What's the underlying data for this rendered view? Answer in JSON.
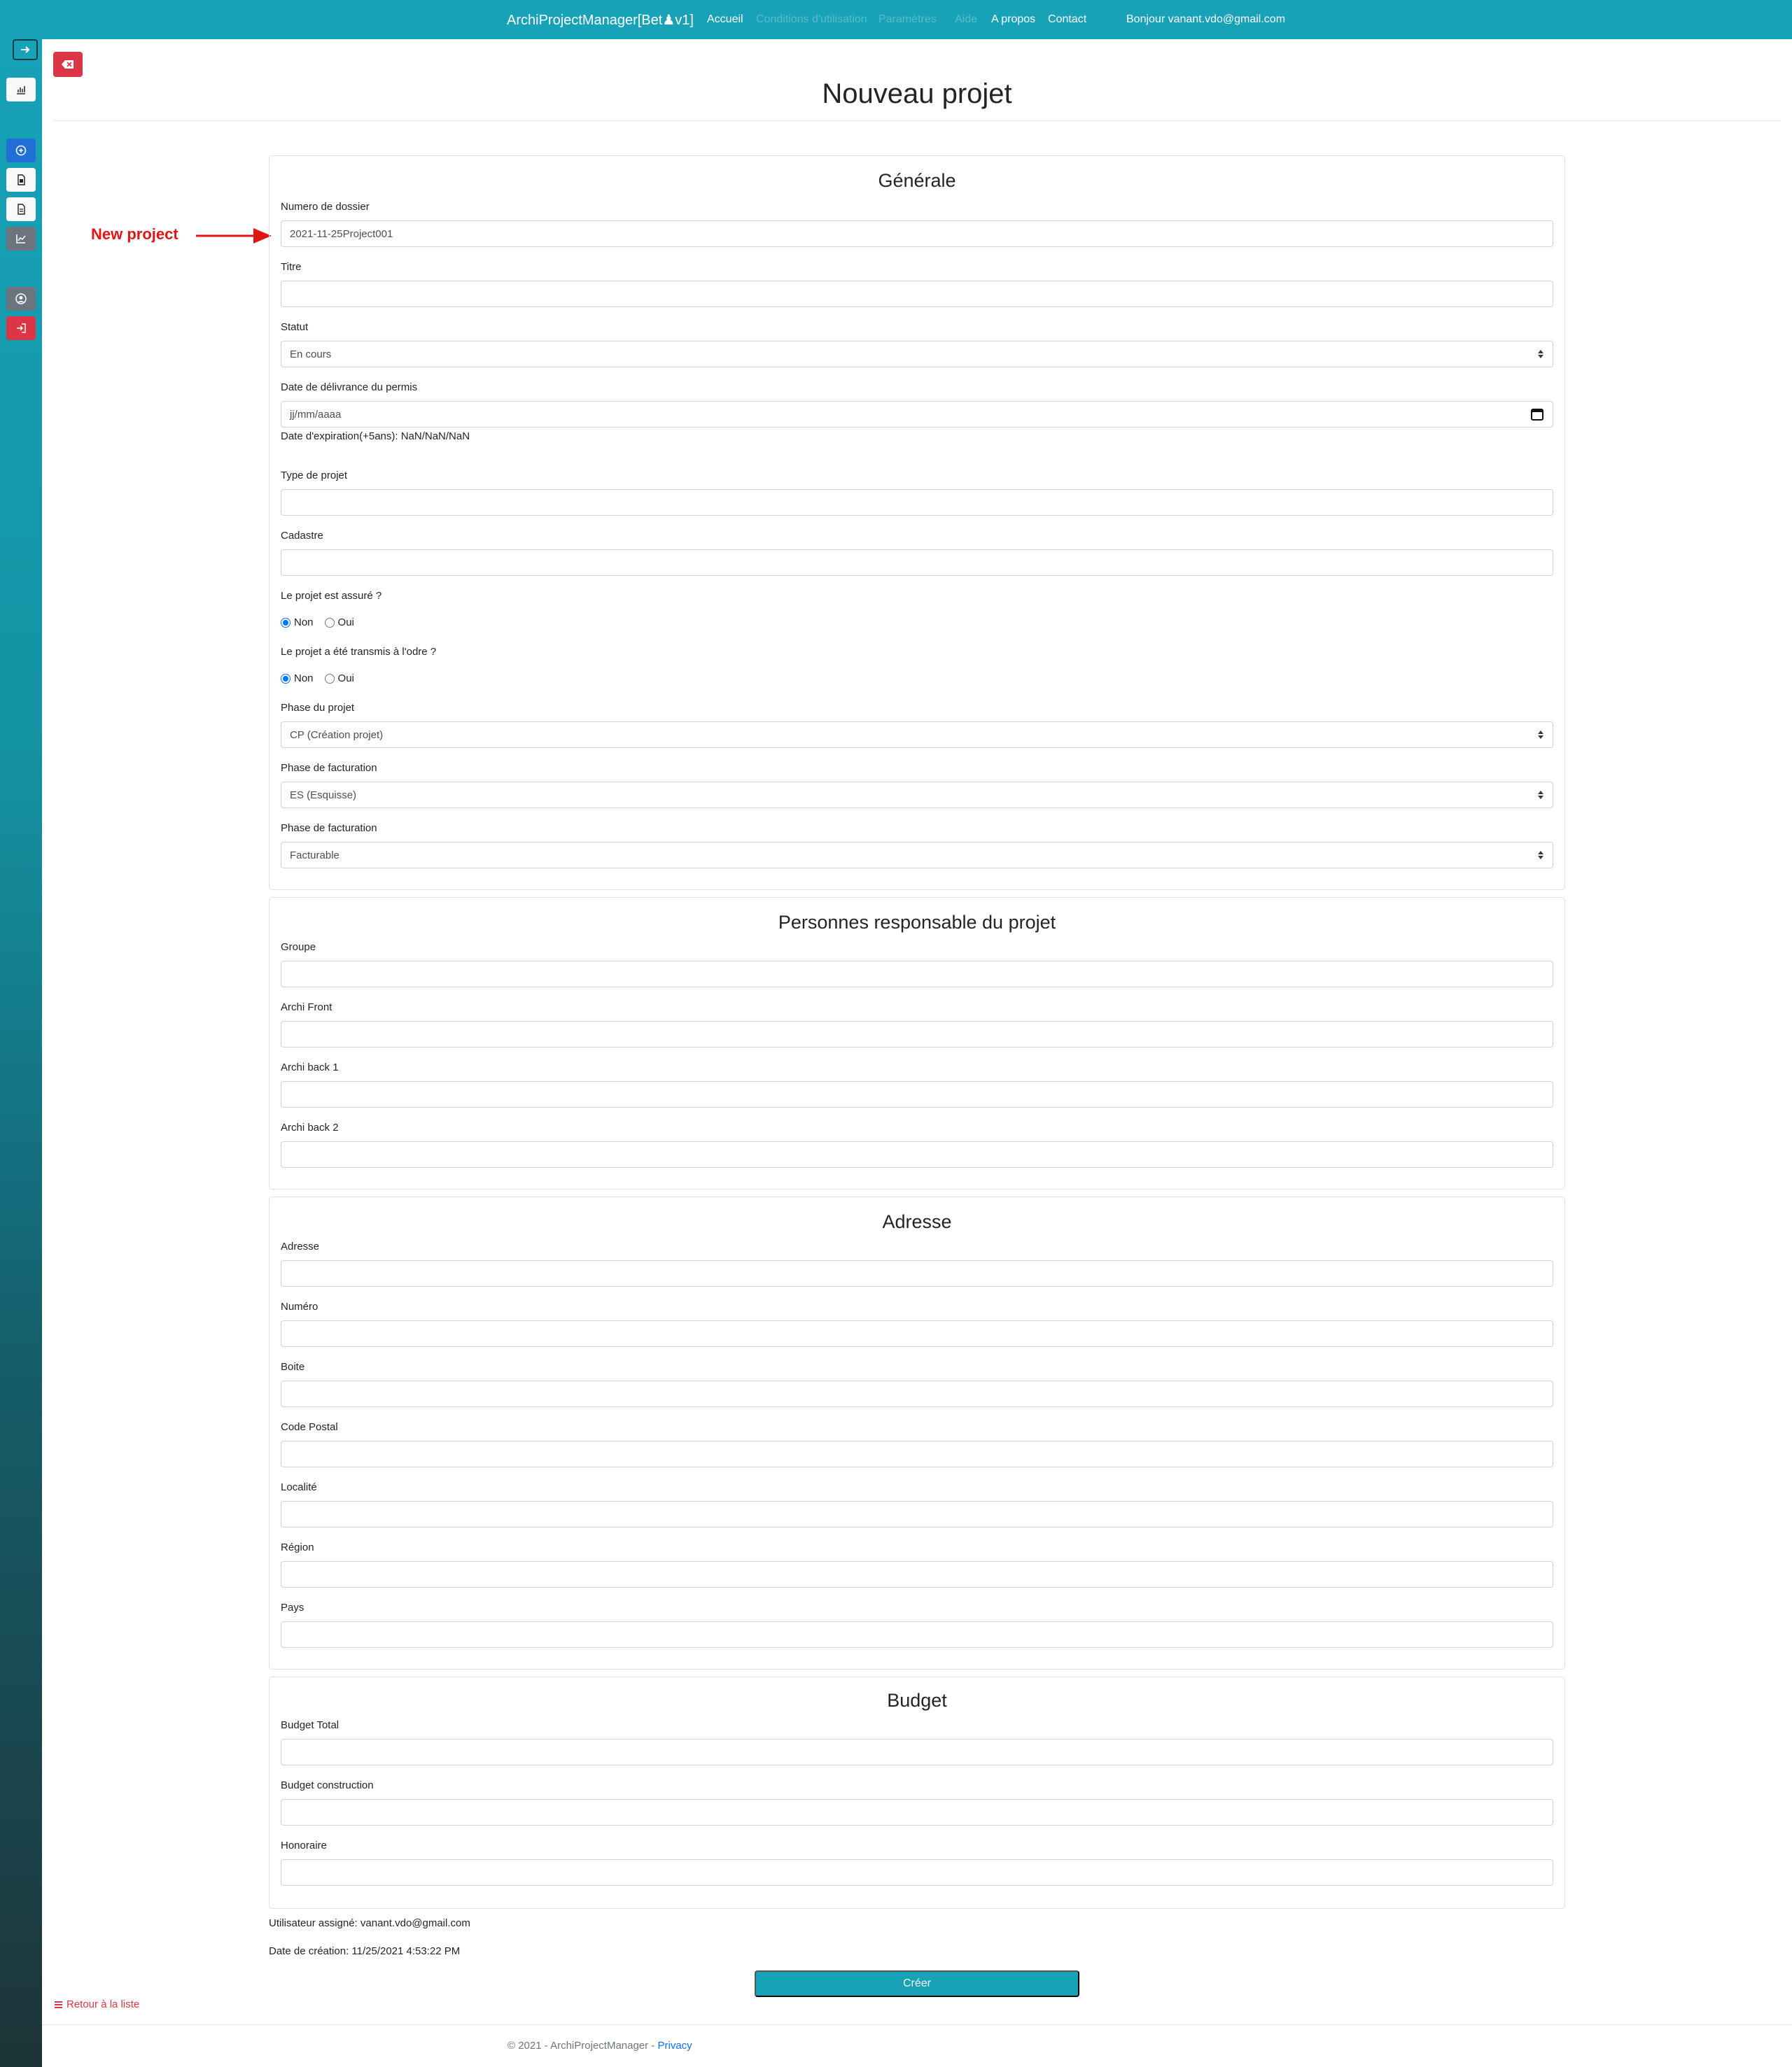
{
  "header": {
    "brand": "ArchiProjectManager[Bet♟v1]",
    "nav": [
      "Accueil",
      "Conditions d'utilisation",
      "Paramètres",
      "Aide",
      "A propos",
      "Contact"
    ],
    "greeting": "Bonjour vanant.vdo@gmail.com"
  },
  "sidebar": {
    "icons": [
      "arrow-right-icon",
      "chart-bar-icon",
      "plus-circle-icon",
      "file-icon",
      "document-icon",
      "line-chart-icon",
      "user-circle-icon",
      "logout-icon"
    ]
  },
  "page": {
    "title": "Nouveau projet",
    "annotation": "New project"
  },
  "sections": {
    "generale": {
      "title": "Générale",
      "numero_label": "Numero de dossier",
      "numero_value": "2021-11-25Project001",
      "titre_label": "Titre",
      "statut_label": "Statut",
      "statut_value": "En cours",
      "date_label": "Date de délivrance du permis",
      "date_placeholder": "jj/mm/aaaa",
      "expiration_text": "Date d'expiration(+5ans): NaN/NaN/NaN",
      "type_label": "Type de projet",
      "cadastre_label": "Cadastre",
      "assure_label": "Le projet est assuré ?",
      "transmis_label": "Le projet a été transmis à l'odre ?",
      "radio_non": "Non",
      "radio_oui": "Oui",
      "phase_projet_label": "Phase du projet",
      "phase_projet_value": "CP (Création projet)",
      "phase_fact_label": "Phase de facturation",
      "phase_fact_value": "ES (Esquisse)",
      "phase_fact2_label": "Phase de facturation",
      "phase_fact2_value": "Facturable"
    },
    "personnes": {
      "title": "Personnes responsable du projet",
      "groupe_label": "Groupe",
      "archi_front_label": "Archi Front",
      "archi_back1_label": "Archi back 1",
      "archi_back2_label": "Archi back 2"
    },
    "adresse": {
      "title": "Adresse",
      "adresse_label": "Adresse",
      "numero_label": "Numéro",
      "boite_label": "Boite",
      "code_postal_label": "Code Postal",
      "localite_label": "Localité",
      "region_label": "Région",
      "pays_label": "Pays"
    },
    "budget": {
      "title": "Budget",
      "total_label": "Budget Total",
      "construction_label": "Budget construction",
      "honoraire_label": "Honoraire"
    }
  },
  "meta": {
    "assigned": "Utilisateur assigné: vanant.vdo@gmail.com",
    "created": "Date de création: 11/25/2021 4:53:22 PM"
  },
  "actions": {
    "create": "Créer",
    "back": "Retour à la liste"
  },
  "footer": {
    "text": "© 2021 - ArchiProjectManager - ",
    "privacy": "Privacy"
  },
  "colors": {
    "primary": "#17a2b8",
    "danger": "#dc3545",
    "annotation": "#e01616"
  }
}
